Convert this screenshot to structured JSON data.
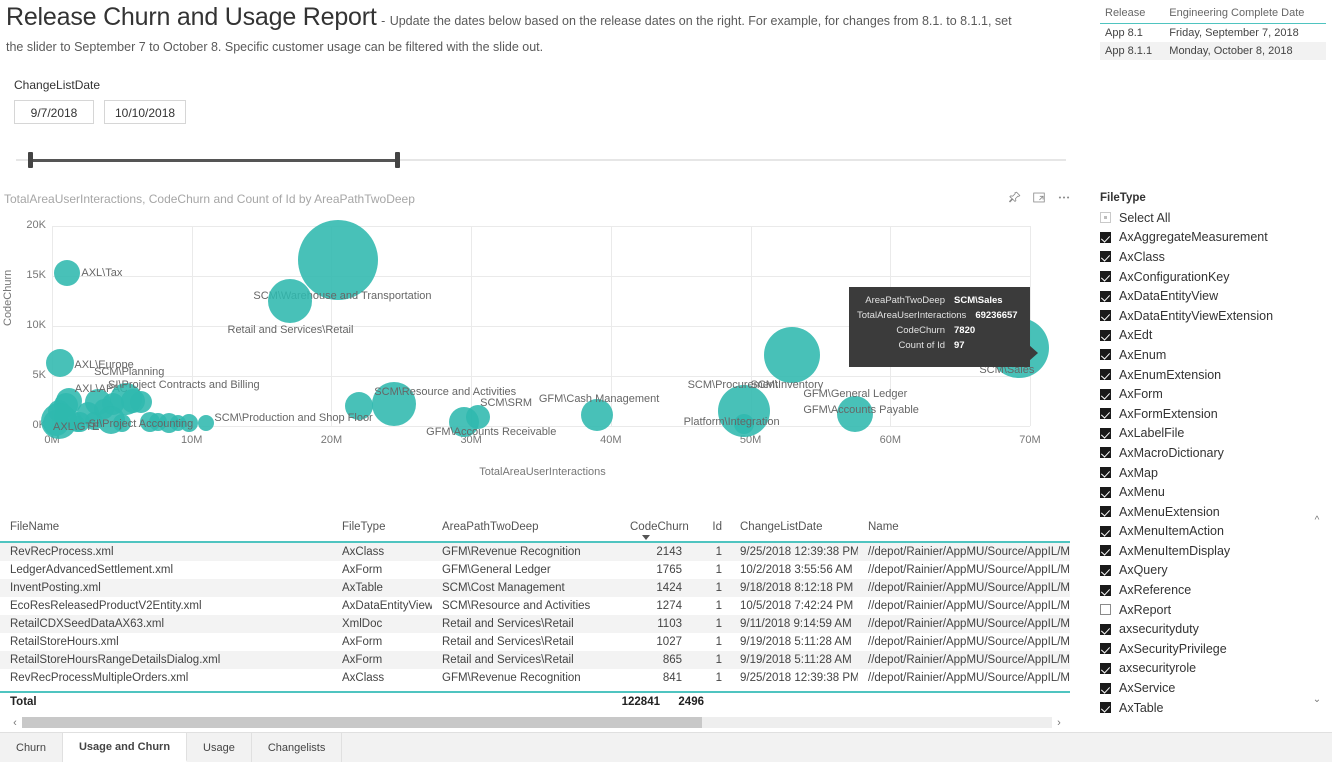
{
  "header": {
    "title": "Release Churn and Usage Report",
    "dash": "-",
    "subtitle_line1": "Update the dates below based on the release dates on the right.  For example, for changes from 8.1. to 8.1.1, set",
    "subtitle_line2": "the slider to September 7 to October 8.   Specific customer usage can be filtered with the slide out."
  },
  "release_table": {
    "columns": [
      "Release",
      "Engineering Complete Date"
    ],
    "rows": [
      [
        "App 8.1",
        "Friday, September 7, 2018"
      ],
      [
        "App 8.1.1",
        "Monday, October 8, 2018"
      ]
    ]
  },
  "slicer": {
    "title": "ChangeListDate",
    "start_value": "9/7/2018",
    "end_value": "10/10/2018"
  },
  "chart": {
    "title": "TotalAreaUserInteractions, CodeChurn and Count of Id by AreaPathTwoDeep",
    "icons": [
      "pin-icon",
      "focus-mode-icon",
      "more-options-icon"
    ],
    "tooltip": {
      "rows": [
        {
          "key": "AreaPathTwoDeep",
          "value": "SCM\\Sales"
        },
        {
          "key": "TotalAreaUserInteractions",
          "value": "69236657"
        },
        {
          "key": "CodeChurn",
          "value": "7820"
        },
        {
          "key": "Count of Id",
          "value": "97"
        }
      ]
    }
  },
  "chart_data": {
    "type": "scatter",
    "title": "TotalAreaUserInteractions, CodeChurn and Count of Id by AreaPathTwoDeep",
    "xlabel": "TotalAreaUserInteractions",
    "ylabel": "CodeChurn",
    "xticks": [
      "0M",
      "10M",
      "20M",
      "30M",
      "40M",
      "50M",
      "60M",
      "70M"
    ],
    "yticks": [
      "0K",
      "5K",
      "10K",
      "15K",
      "20K"
    ],
    "xlim": [
      0,
      70000000
    ],
    "ylim": [
      0,
      20000
    ],
    "size_measure": "Count of Id",
    "grid": true,
    "legend": "none",
    "points": [
      {
        "label": "AXL\\Tax",
        "x": 1100000,
        "y": 15300,
        "size": 13,
        "label_dx": 14,
        "label_dy": -6
      },
      {
        "label": "SCM\\Warehouse and Transportation",
        "x": 20500000,
        "y": 16600,
        "size": 40,
        "label_dx": -85,
        "label_dy": 30
      },
      {
        "label": "Retail and Services\\Retail",
        "x": 17000000,
        "y": 12500,
        "size": 22,
        "label_dx": -62,
        "label_dy": 23
      },
      {
        "label": "AXL\\Europe",
        "x": 600000,
        "y": 6300,
        "size": 14,
        "label_dx": 14,
        "label_dy": -4
      },
      {
        "label": "SCM\\Planning",
        "x": 3300000,
        "y": 2400,
        "size": 13,
        "label_dx": -4,
        "label_dy": -36
      },
      {
        "label": "AXL\\APAC",
        "x": 1200000,
        "y": 2500,
        "size": 13,
        "label_dx": 6,
        "label_dy": -18
      },
      {
        "label": "SI\\Project Contracts and Billing",
        "x": 5300000,
        "y": 2700,
        "size": 16,
        "label_dx": -18,
        "label_dy": -20
      },
      {
        "label": "SCM\\Production and Shop Floor",
        "x": 22000000,
        "y": 2000,
        "size": 14,
        "label_dx": -145,
        "label_dy": 6
      },
      {
        "label": "SI\\Project Accounting",
        "x": 4200000,
        "y": 600,
        "size": 14,
        "label_dx": -22,
        "label_dy": -2
      },
      {
        "label": "AXL\\GTE",
        "x": 500000,
        "y": 500,
        "size": 18,
        "label_dx": -6,
        "label_dy": 0
      },
      {
        "label": "SCM\\Resource and Activities",
        "x": 24500000,
        "y": 2200,
        "size": 22,
        "label_dx": -20,
        "label_dy": -18
      },
      {
        "label": "GFM\\Accounts Receivable",
        "x": 29500000,
        "y": 400,
        "size": 15,
        "label_dx": -38,
        "label_dy": 4
      },
      {
        "label": "SCM\\SRM",
        "x": 30500000,
        "y": 900,
        "size": 12,
        "label_dx": 2,
        "label_dy": -20
      },
      {
        "label": "GFM\\Cash Management",
        "x": 39000000,
        "y": 1100,
        "size": 16,
        "label_dx": -58,
        "label_dy": -22
      },
      {
        "label": "SCM\\Procurement",
        "x": 49500000,
        "y": 1500,
        "size": 26,
        "label_dx": -56,
        "label_dy": -32
      },
      {
        "label": "Platform\\Integration",
        "x": 49500000,
        "y": 200,
        "size": 10,
        "label_dx": -60,
        "label_dy": -8
      },
      {
        "label": "SCM\\Inventory",
        "x": 53000000,
        "y": 7100,
        "size": 28,
        "label_dx": -42,
        "label_dy": 24
      },
      {
        "label": "GFM\\General Ledger",
        "x": 57500000,
        "y": 1200,
        "size": 18,
        "label_dx": -52,
        "label_dy": -26
      },
      {
        "label": "GFM\\Accounts Payable",
        "x": 57500000,
        "y": 1200,
        "size": 0,
        "label_dx": -52,
        "label_dy": -10
      },
      {
        "label": "SCM\\Sales",
        "x": 69236657,
        "y": 7820,
        "size": 30,
        "label_dx": -40,
        "label_dy": 16
      }
    ]
  },
  "data_table": {
    "columns": [
      "FileName",
      "FileType",
      "AreaPathTwoDeep",
      "CodeChurn",
      "Id",
      "ChangeListDate",
      "Name"
    ],
    "sorted_column": "CodeChurn",
    "rows": [
      [
        "RevRecProcess.xml",
        "AxClass",
        "GFM\\Revenue Recognition",
        "2143",
        "1",
        "9/25/2018 12:39:38 PM",
        "//depot/Rainier/AppMU/Source/AppIL/Meta"
      ],
      [
        "LedgerAdvancedSettlement.xml",
        "AxForm",
        "GFM\\General Ledger",
        "1765",
        "1",
        "10/2/2018 3:55:56 AM",
        "//depot/Rainier/AppMU/Source/AppIL/Meta"
      ],
      [
        "InventPosting.xml",
        "AxTable",
        "SCM\\Cost Management",
        "1424",
        "1",
        "9/18/2018 8:12:18 PM",
        "//depot/Rainier/AppMU/Source/AppIL/Meta"
      ],
      [
        "EcoResReleasedProductV2Entity.xml",
        "AxDataEntityView",
        "SCM\\Resource and Activities",
        "1274",
        "1",
        "10/5/2018 7:42:24 PM",
        "//depot/Rainier/AppMU/Source/AppIL/Meta"
      ],
      [
        "RetailCDXSeedDataAX63.xml",
        "XmlDoc",
        "Retail and Services\\Retail",
        "1103",
        "1",
        "9/11/2018 9:14:59 AM",
        "//depot/Rainier/AppMU/Source/AppIL/Meta"
      ],
      [
        "RetailStoreHours.xml",
        "AxForm",
        "Retail and Services\\Retail",
        "1027",
        "1",
        "9/19/2018 5:11:28 AM",
        "//depot/Rainier/AppMU/Source/AppIL/Meta"
      ],
      [
        "RetailStoreHoursRangeDetailsDialog.xml",
        "AxForm",
        "Retail and Services\\Retail",
        "865",
        "1",
        "9/19/2018 5:11:28 AM",
        "//depot/Rainier/AppMU/Source/AppIL/Meta"
      ],
      [
        "RevRecProcessMultipleOrders.xml",
        "AxClass",
        "GFM\\Revenue Recognition",
        "841",
        "1",
        "9/25/2018 12:39:38 PM",
        "//depot/Rainier/AppMU/Source/AppIL/Meta"
      ]
    ],
    "total_label": "Total",
    "total_codechurn": "122841",
    "total_id": "2496"
  },
  "filter": {
    "title": "FileType",
    "select_all_label": "Select All",
    "items": [
      {
        "label": "AxAggregateMeasurement",
        "checked": true
      },
      {
        "label": "AxClass",
        "checked": true
      },
      {
        "label": "AxConfigurationKey",
        "checked": true
      },
      {
        "label": "AxDataEntityView",
        "checked": true
      },
      {
        "label": "AxDataEntityViewExtension",
        "checked": true
      },
      {
        "label": "AxEdt",
        "checked": true
      },
      {
        "label": "AxEnum",
        "checked": true
      },
      {
        "label": "AxEnumExtension",
        "checked": true
      },
      {
        "label": "AxForm",
        "checked": true
      },
      {
        "label": "AxFormExtension",
        "checked": true
      },
      {
        "label": "AxLabelFile",
        "checked": true
      },
      {
        "label": "AxMacroDictionary",
        "checked": true
      },
      {
        "label": "AxMap",
        "checked": true
      },
      {
        "label": "AxMenu",
        "checked": true
      },
      {
        "label": "AxMenuExtension",
        "checked": true
      },
      {
        "label": "AxMenuItemAction",
        "checked": true
      },
      {
        "label": "AxMenuItemDisplay",
        "checked": true
      },
      {
        "label": "AxQuery",
        "checked": true
      },
      {
        "label": "AxReference",
        "checked": true
      },
      {
        "label": "AxReport",
        "checked": false
      },
      {
        "label": "axsecurityduty",
        "checked": true
      },
      {
        "label": "AxSecurityPrivilege",
        "checked": true
      },
      {
        "label": "axsecurityrole",
        "checked": true
      },
      {
        "label": "AxService",
        "checked": true
      },
      {
        "label": "AxTable",
        "checked": true
      }
    ]
  },
  "tabs": [
    {
      "label": "Churn",
      "active": false
    },
    {
      "label": "Usage and Churn",
      "active": true
    },
    {
      "label": "Usage",
      "active": false
    },
    {
      "label": "Changelists",
      "active": false
    }
  ],
  "colors": {
    "accent": "#4fc4c0",
    "bubble": "#2fb8ae",
    "tooltip_bg": "#3b3b3b"
  }
}
